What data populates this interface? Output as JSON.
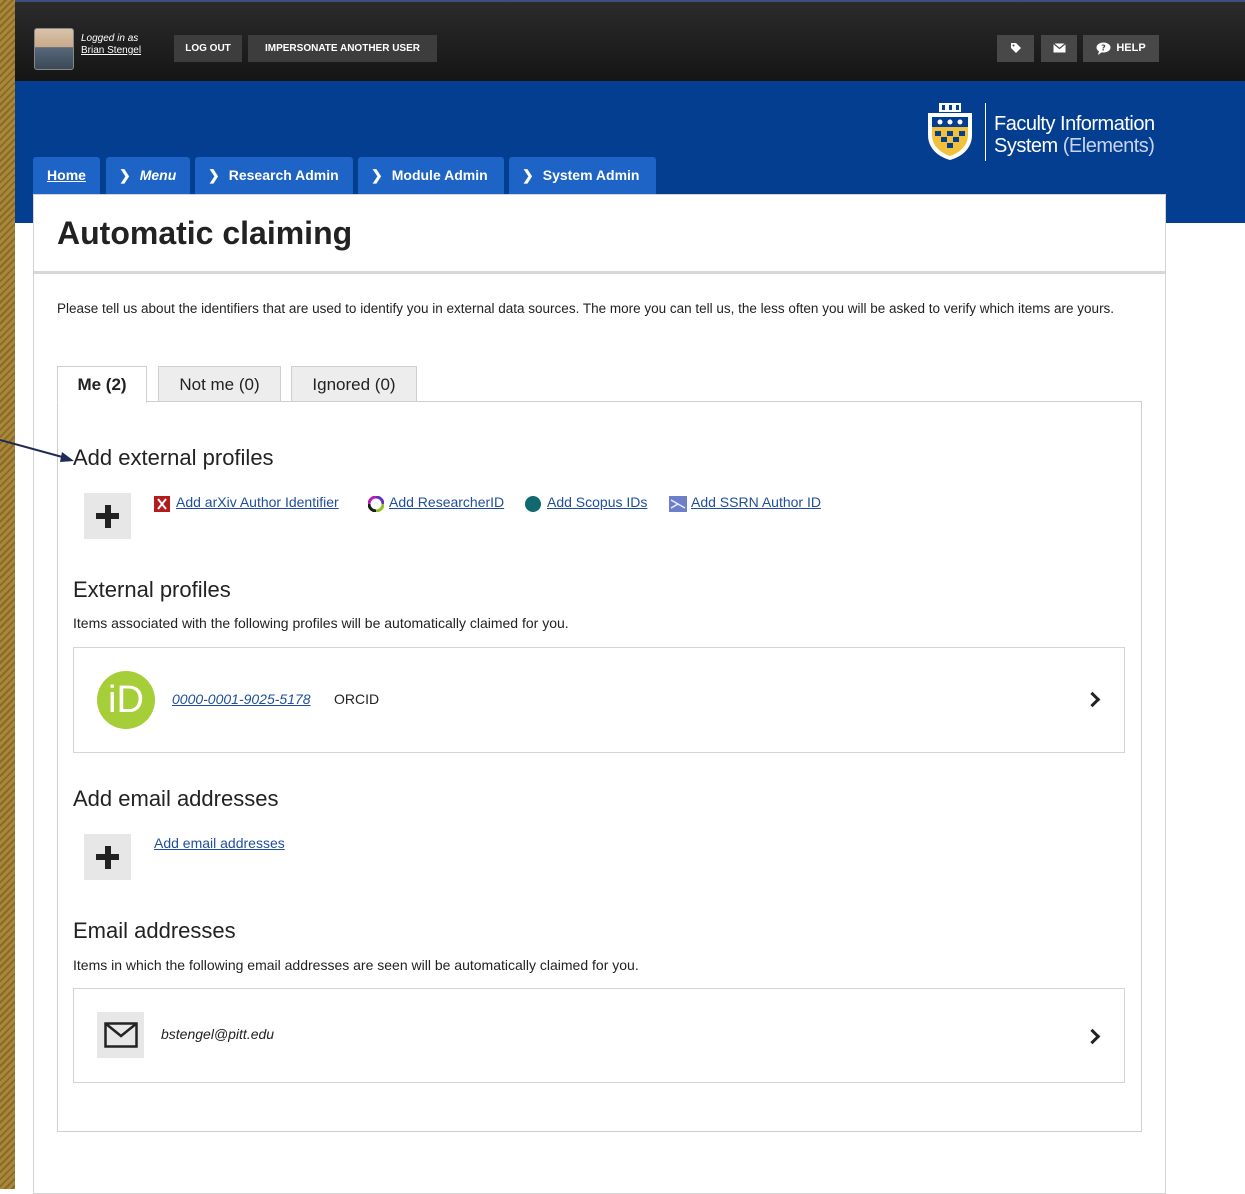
{
  "header": {
    "logged_in_as": "Logged in as",
    "user_name": "Brian Stengel",
    "logout": "LOG OUT",
    "impersonate": "IMPERSONATE ANOTHER USER",
    "help": "HELP"
  },
  "brand": {
    "line1": "Faculty Information",
    "line2_a": "System",
    "line2_b": "(Elements)"
  },
  "nav": {
    "home": "Home",
    "menu": "Menu",
    "research_admin": "Research Admin",
    "module_admin": "Module Admin",
    "system_admin": "System Admin"
  },
  "page": {
    "title": "Automatic claiming",
    "intro": "Please tell us about the identifiers that are used to identify you in external data sources. The more you can tell us, the less often you will be asked to verify which items are yours."
  },
  "tabs": {
    "me": "Me (2)",
    "not_me": "Not me (0)",
    "ignored": "Ignored (0)"
  },
  "add_profiles": {
    "heading": "Add external profiles",
    "arxiv": "Add arXiv Author Identifier",
    "researcherid": "Add ResearcherID",
    "scopus": "Add Scopus IDs",
    "ssrn": "Add SSRN Author ID"
  },
  "profiles": {
    "heading": "External profiles",
    "description": "Items associated with the following profiles will be automatically claimed for you.",
    "orcid_id": "0000-0001-9025-5178",
    "orcid_label": "ORCID"
  },
  "add_emails": {
    "heading": "Add email addresses",
    "link": "Add email addresses"
  },
  "emails": {
    "heading": "Email addresses",
    "description": "Items in which the following email addresses are seen will be automatically claimed for you.",
    "address": "bstengel@pitt.edu"
  },
  "colors": {
    "banner": "#043e91",
    "nav_tab": "#1e64c6",
    "link": "#1f4e9a",
    "orcid": "#a6ce39"
  }
}
